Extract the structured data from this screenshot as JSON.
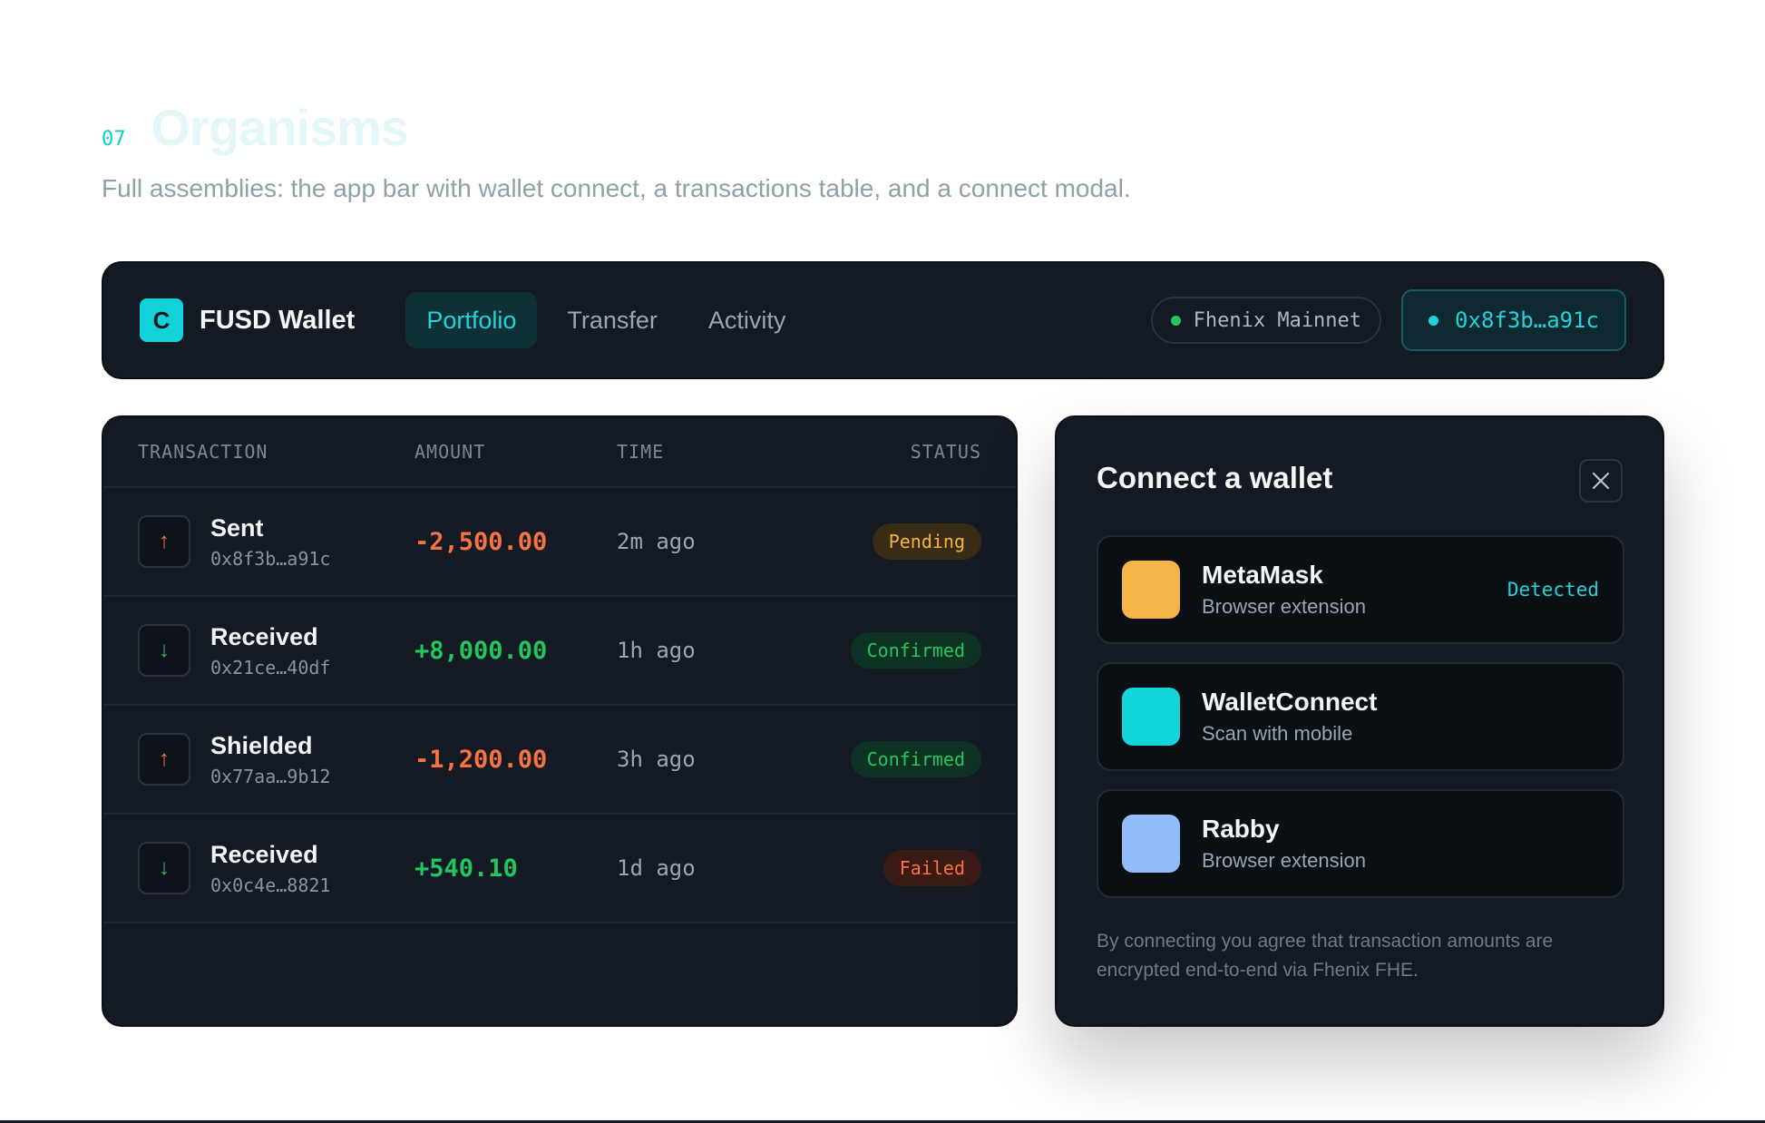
{
  "section": {
    "number": "07",
    "title": "Organisms",
    "description": "Full assemblies: the app bar with wallet connect, a transactions table, and a connect modal."
  },
  "appbar": {
    "logo_letter": "C",
    "brand": "FUSD Wallet",
    "tabs": [
      {
        "label": "Portfolio",
        "active": true
      },
      {
        "label": "Transfer",
        "active": false
      },
      {
        "label": "Activity",
        "active": false
      }
    ],
    "network": "Fhenix Mainnet",
    "account": "0x8f3b…a91c"
  },
  "transactions": {
    "headers": {
      "transaction": "TRANSACTION",
      "amount": "AMOUNT",
      "time": "TIME",
      "status": "STATUS"
    },
    "rows": [
      {
        "direction": "up",
        "icon": "arrow-up-icon",
        "name": "Sent",
        "address": "0x8f3b…a91c",
        "amount": "-2,500.00",
        "sign": "neg",
        "time": "2m ago",
        "status": "Pending",
        "status_kind": "pending"
      },
      {
        "direction": "down",
        "icon": "arrow-down-icon",
        "name": "Received",
        "address": "0x21ce…40df",
        "amount": "+8,000.00",
        "sign": "pos",
        "time": "1h ago",
        "status": "Confirmed",
        "status_kind": "confirmed"
      },
      {
        "direction": "up",
        "icon": "arrow-up-icon",
        "name": "Shielded",
        "address": "0x77aa…9b12",
        "amount": "-1,200.00",
        "sign": "neg",
        "time": "3h ago",
        "status": "Confirmed",
        "status_kind": "confirmed"
      },
      {
        "direction": "down",
        "icon": "arrow-down-icon",
        "name": "Received",
        "address": "0x0c4e…8821",
        "amount": "+540.10",
        "sign": "pos",
        "time": "1d ago",
        "status": "Failed",
        "status_kind": "failed"
      }
    ]
  },
  "modal": {
    "title": "Connect a wallet",
    "close_icon": "close-icon",
    "wallets": [
      {
        "name": "MetaMask",
        "subtitle": "Browser extension",
        "tag": "Detected",
        "color": "#f5b547"
      },
      {
        "name": "WalletConnect",
        "subtitle": "Scan with mobile",
        "tag": "",
        "color": "#12d6dc"
      },
      {
        "name": "Rabby",
        "subtitle": "Browser extension",
        "tag": "",
        "color": "#93bdfd"
      }
    ],
    "footer": "By connecting you agree that transaction amounts are encrypted end-to-end via Fhenix FHE."
  },
  "colors": {
    "accent": "#22d3dc",
    "positive": "#22c55e",
    "negative": "#f97341",
    "warning": "#f3b53f",
    "panel": "#131a23"
  }
}
